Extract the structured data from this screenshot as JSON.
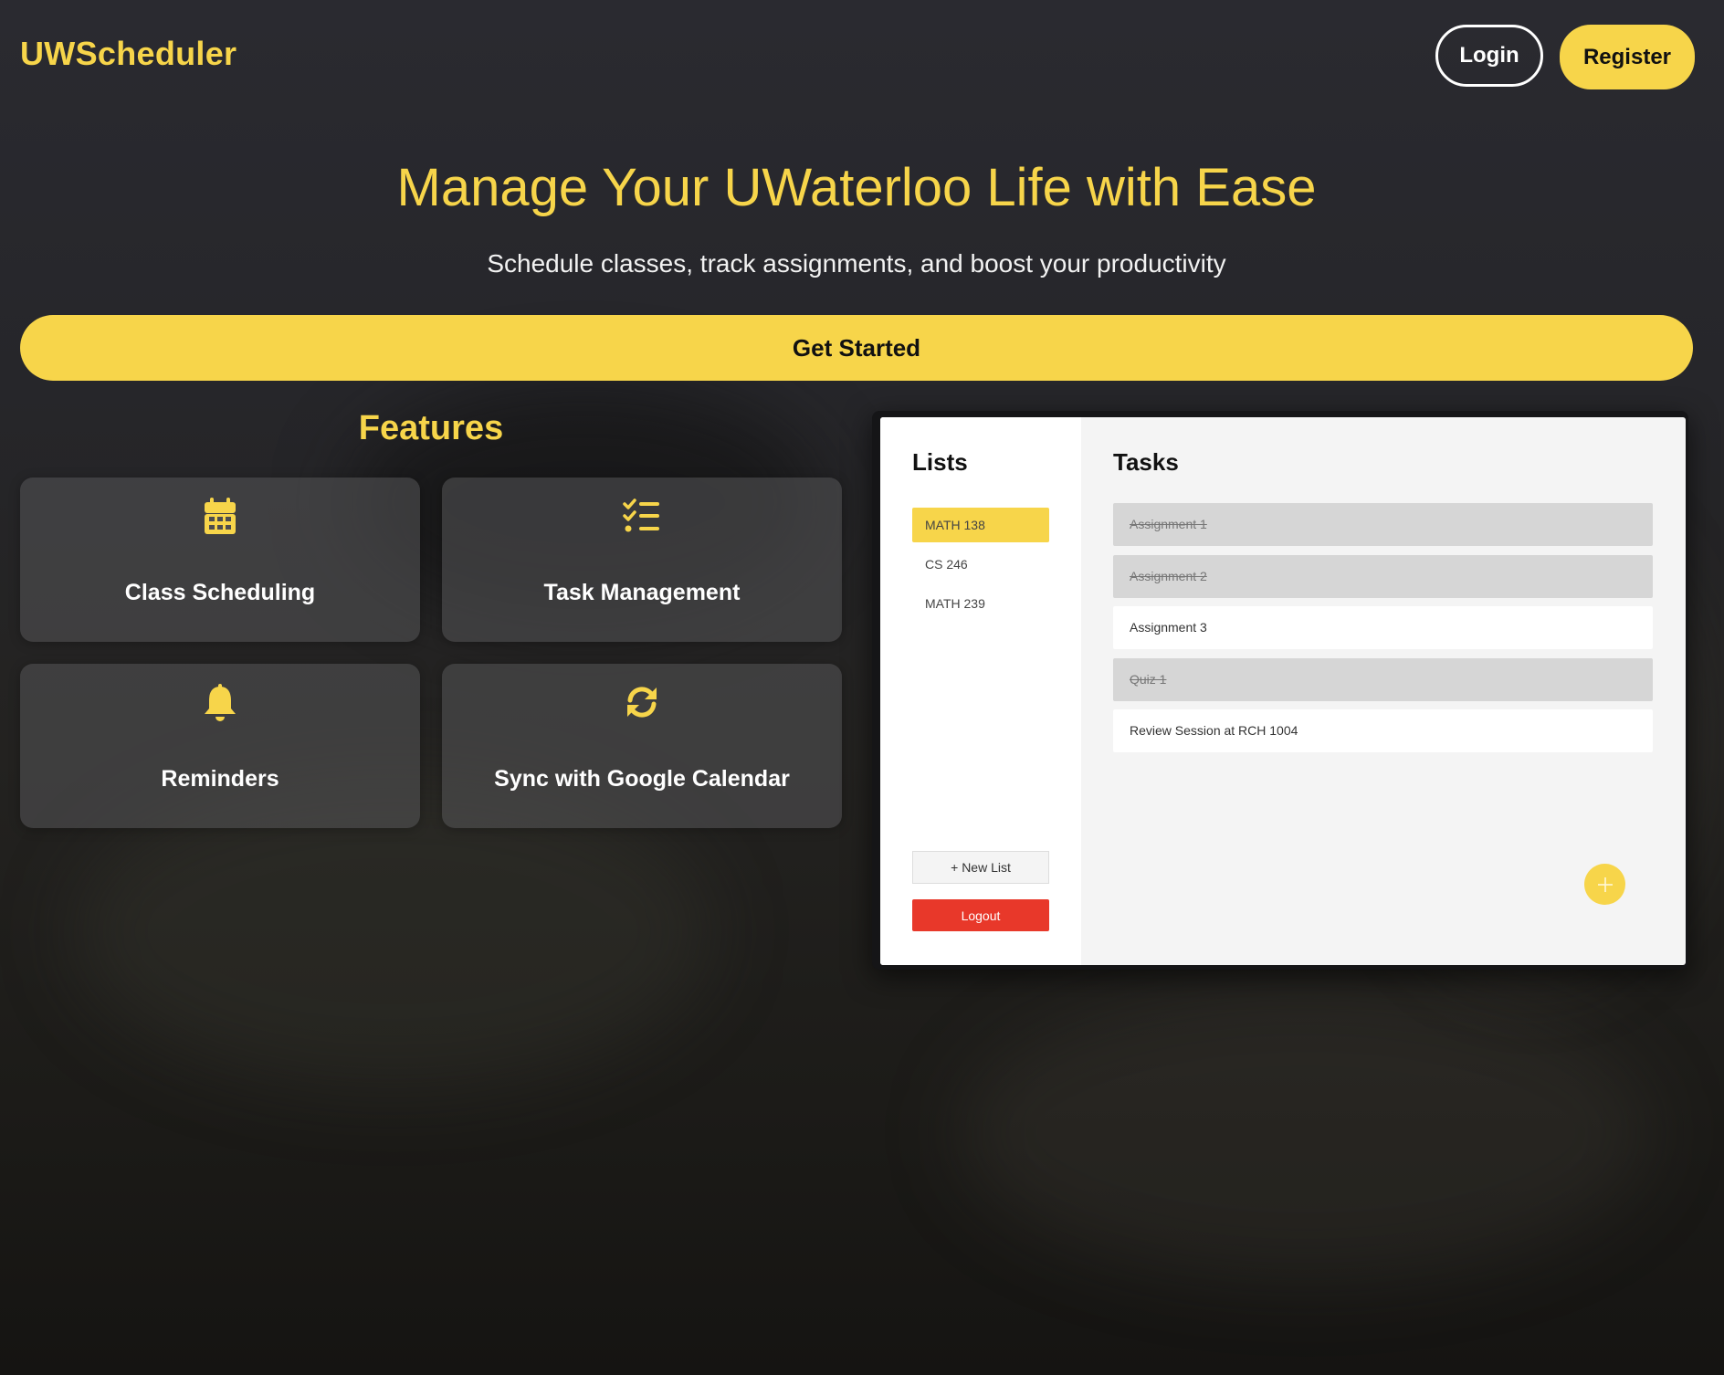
{
  "header": {
    "logo": "UWScheduler",
    "login_label": "Login",
    "register_label": "Register"
  },
  "hero": {
    "title": "Manage Your UWaterloo Life with Ease",
    "subtitle": "Schedule classes, track assignments, and boost your productivity",
    "cta_label": "Get Started"
  },
  "features": {
    "title": "Features",
    "items": [
      {
        "label": "Class Scheduling",
        "icon": "calendar-icon"
      },
      {
        "label": "Task Management",
        "icon": "checklist-icon"
      },
      {
        "label": "Reminders",
        "icon": "bell-icon"
      },
      {
        "label": "Sync with Google Calendar",
        "icon": "sync-icon"
      }
    ]
  },
  "preview": {
    "lists_heading": "Lists",
    "tasks_heading": "Tasks",
    "lists": [
      {
        "label": "MATH 138",
        "active": true
      },
      {
        "label": "CS 246",
        "active": false
      },
      {
        "label": "MATH 239",
        "active": false
      }
    ],
    "tasks": [
      {
        "label": "Assignment 1",
        "done": true
      },
      {
        "label": "Assignment 2",
        "done": true
      },
      {
        "label": "Assignment 3",
        "done": false
      },
      {
        "label": "Quiz 1",
        "done": true
      },
      {
        "label": "Review Session at RCH 1004",
        "done": false
      }
    ],
    "new_list_label": "+ New List",
    "logout_label": "Logout",
    "add_task_icon": "plus-icon"
  },
  "colors": {
    "accent": "#f7d54a",
    "danger": "#e8382a",
    "completed_task_bg": "#d6d6d6"
  }
}
